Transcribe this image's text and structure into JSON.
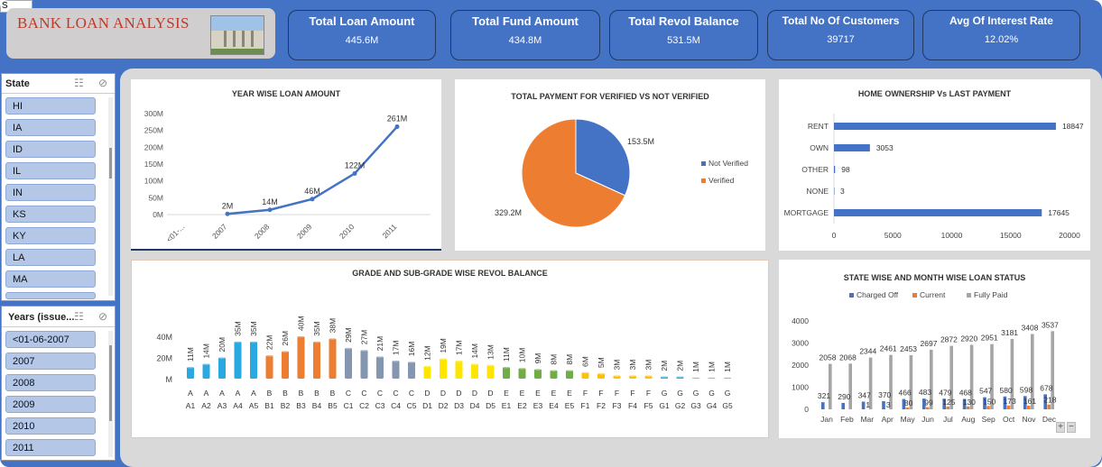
{
  "cell_ref": "S",
  "header": {
    "title": "BANK LOAN ANALYSIS"
  },
  "kpis": [
    {
      "label": "Total  Loan Amount",
      "value": "445.6M"
    },
    {
      "label": "Total  Fund Amount",
      "value": "434.8M"
    },
    {
      "label": "Total  Revol Balance",
      "value": "531.5M"
    },
    {
      "label": "Total No Of  Customers",
      "value": "39717"
    },
    {
      "label": "Avg Of  Interest Rate",
      "value": "12.02%"
    }
  ],
  "slicers": {
    "state": {
      "header": "State",
      "items": [
        "HI",
        "IA",
        "ID",
        "IL",
        "IN",
        "KS",
        "KY",
        "LA",
        "MA"
      ]
    },
    "years": {
      "header": "Years (issue...",
      "items": [
        "<01-06-2007",
        "2007",
        "2008",
        "2009",
        "2010",
        "2011"
      ]
    }
  },
  "chart_data": [
    {
      "type": "line",
      "title": "YEAR WISE LOAN AMOUNT",
      "x": [
        "<01-...",
        "2007",
        "2008",
        "2009",
        "2010",
        "2011"
      ],
      "series": [
        {
          "values": [
            null,
            2,
            14,
            46,
            122,
            261
          ]
        }
      ],
      "data_labels": [
        "",
        "2M",
        "14M",
        "46M",
        "122M",
        "261M"
      ],
      "yticks": [
        "0M",
        "50M",
        "100M",
        "150M",
        "200M",
        "250M",
        "300M"
      ],
      "ylim": [
        0,
        300
      ]
    },
    {
      "type": "pie",
      "title": "TOTAL PAYMENT FOR VERIFIED VS NOT VERIFIED",
      "slices": [
        {
          "name": "Not Verified",
          "value": 153.5,
          "label": "153.5M",
          "color": "#4472c4"
        },
        {
          "name": "Verified",
          "value": 329.2,
          "label": "329.2M",
          "color": "#ed7d31"
        }
      ],
      "legend_position": "right"
    },
    {
      "type": "bar",
      "title": "HOME OWNERSHIP Vs LAST PAYMENT",
      "orientation": "horizontal",
      "categories": [
        "RENT",
        "OWN",
        "OTHER",
        "NONE",
        "MORTGAGE"
      ],
      "values": [
        18847,
        3053,
        98,
        3,
        17645
      ],
      "xticks": [
        "0",
        "5000",
        "10000",
        "15000",
        "20000"
      ],
      "xlim": [
        0,
        20000
      ]
    },
    {
      "type": "bar",
      "title": "GRADE AND SUB-GRADE WISE REVOL BALANCE",
      "groups": [
        "A",
        "B",
        "C",
        "D",
        "E",
        "F",
        "G"
      ],
      "categories": [
        "A1",
        "A2",
        "A3",
        "A4",
        "A5",
        "B1",
        "B2",
        "B3",
        "B4",
        "B5",
        "C1",
        "C2",
        "C3",
        "C4",
        "C5",
        "D1",
        "D2",
        "D3",
        "D4",
        "D5",
        "E1",
        "E2",
        "E3",
        "E4",
        "E5",
        "F1",
        "F2",
        "F3",
        "F4",
        "F5",
        "G1",
        "G2",
        "G3",
        "G4",
        "G5"
      ],
      "values": [
        11,
        14,
        20,
        35,
        35,
        22,
        26,
        40,
        35,
        38,
        29,
        27,
        21,
        17,
        16,
        12,
        19,
        17,
        14,
        13,
        11,
        10,
        9,
        8,
        8,
        6,
        5,
        3,
        3,
        3,
        2,
        2,
        1,
        1,
        1
      ],
      "data_labels": [
        "11M",
        "14M",
        "20M",
        "35M",
        "35M",
        "22M",
        "26M",
        "40M",
        "35M",
        "38M",
        "29M",
        "27M",
        "21M",
        "17M",
        "16M",
        "12M",
        "19M",
        "17M",
        "14M",
        "13M",
        "11M",
        "10M",
        "9M",
        "8M",
        "8M",
        "6M",
        "5M",
        "3M",
        "3M",
        "3M",
        "2M",
        "2M",
        "1M",
        "1M",
        "1M"
      ],
      "yticks": [
        "M",
        "20M",
        "40M"
      ],
      "group_colors": {
        "A": "#2aa8e0",
        "B": "#ed7d31",
        "C": "#8496b0",
        "D": "#ffe600",
        "E": "#70ad47",
        "F": "#ffc000",
        "G": "#2aa8e0"
      }
    },
    {
      "type": "bar",
      "title": "STATE WISE AND MONTH WISE LOAN STATUS",
      "categories": [
        "Jan",
        "Feb",
        "Mar",
        "Apr",
        "May",
        "Jun",
        "Jul",
        "Aug",
        "Sep",
        "Oct",
        "Nov",
        "Dec"
      ],
      "series": [
        {
          "name": "Charged Off",
          "color": "#4472c4",
          "values": [
            321,
            290,
            347,
            370,
            466,
            483,
            479,
            468,
            547,
            580,
            598,
            678
          ]
        },
        {
          "name": "Current",
          "color": "#ed7d31",
          "values": [
            null,
            null,
            1,
            3,
            80,
            99,
            125,
            130,
            150,
            173,
            161,
            218
          ]
        },
        {
          "name": "Fully Paid",
          "color": "#a5a5a5",
          "values": [
            2058,
            2068,
            2344,
            2461,
            2453,
            2697,
            2872,
            2920,
            2951,
            3181,
            3408,
            3537
          ]
        }
      ],
      "yticks": [
        "0",
        "1000",
        "2000",
        "3000",
        "4000"
      ],
      "ylim": [
        0,
        4000
      ],
      "legend_position": "top"
    }
  ]
}
